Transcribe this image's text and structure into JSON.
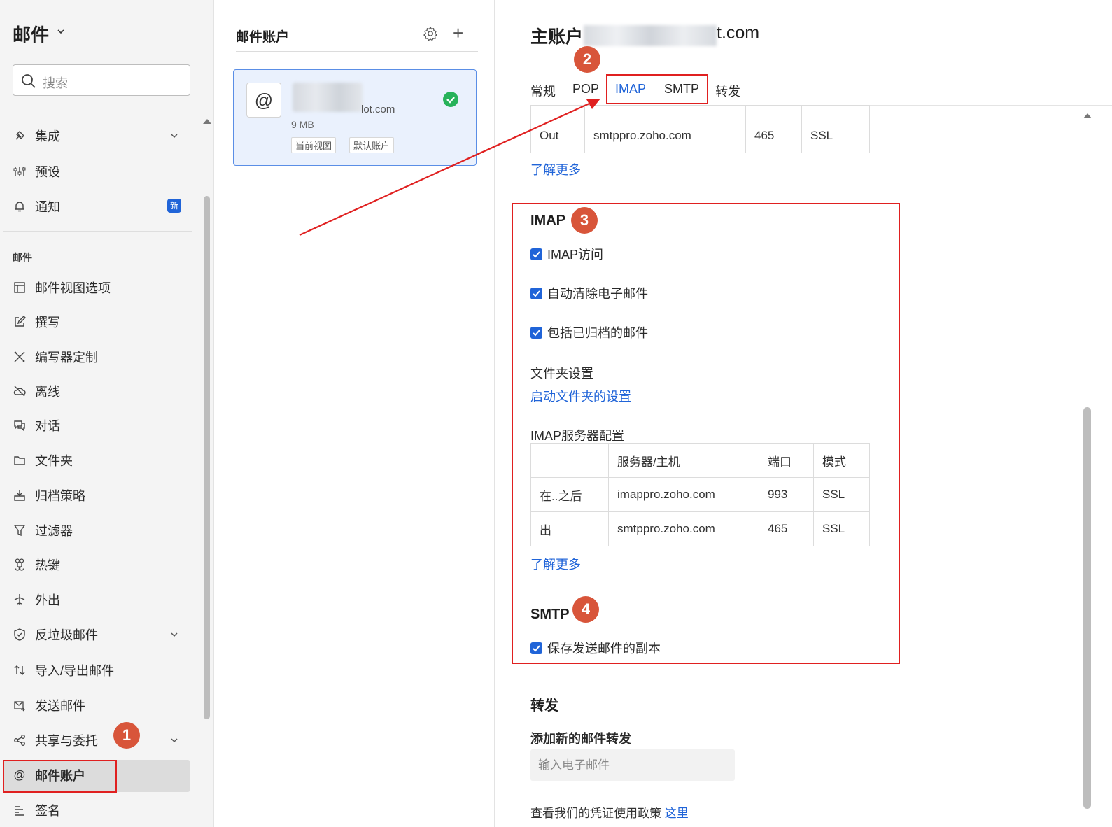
{
  "sidebar": {
    "app_title": "邮件",
    "search_placeholder": "搜索",
    "items_top": [
      {
        "label": "集成",
        "icon": "plug-icon",
        "has_chevron": true
      },
      {
        "label": "预设",
        "icon": "sliders-icon"
      },
      {
        "label": "通知",
        "icon": "bell-icon",
        "badge": "新"
      }
    ],
    "section_label": "邮件",
    "items_mail": [
      {
        "label": "邮件视图选项",
        "icon": "layout-icon"
      },
      {
        "label": "撰写",
        "icon": "compose-icon"
      },
      {
        "label": "编写器定制",
        "icon": "tools-icon"
      },
      {
        "label": "离线",
        "icon": "cloud-off-icon"
      },
      {
        "label": "对话",
        "icon": "chat-icon"
      },
      {
        "label": "文件夹",
        "icon": "folder-icon"
      },
      {
        "label": "归档策略",
        "icon": "archive-icon"
      },
      {
        "label": "过滤器",
        "icon": "filter-icon"
      },
      {
        "label": "热键",
        "icon": "command-icon"
      },
      {
        "label": "外出",
        "icon": "plane-icon"
      },
      {
        "label": "反垃圾邮件",
        "icon": "shield-icon",
        "has_chevron": true
      },
      {
        "label": "导入/导出邮件",
        "icon": "import-export-icon"
      },
      {
        "label": "发送邮件",
        "icon": "send-mail-icon"
      },
      {
        "label": "共享与委托",
        "icon": "share-icon",
        "has_chevron": true
      },
      {
        "label": "邮件账户",
        "icon": "at-icon",
        "active": true
      },
      {
        "label": "签名",
        "icon": "signature-icon"
      }
    ]
  },
  "middle": {
    "title": "邮件账户",
    "account": {
      "email_suffix": "lot.com",
      "size": "9 MB",
      "tags": [
        "当前视图",
        "默认账户"
      ]
    }
  },
  "right": {
    "heading_prefix": "主账户",
    "heading_suffix": "t.com",
    "tabs": [
      "常规",
      "POP",
      "IMAP",
      "SMTP",
      "转发"
    ],
    "active_tab": "IMAP",
    "pop_table_row": [
      "Out",
      "smtppro.zoho.com",
      "465",
      "SSL"
    ],
    "learn_more": "了解更多",
    "imap": {
      "title": "IMAP",
      "checkboxes": [
        "IMAP访问",
        "自动清除电子邮件",
        "包括已归档的邮件"
      ],
      "folder_settings_label": "文件夹设置",
      "folder_settings_link": "启动文件夹的设置",
      "server_config_label": "IMAP服务器配置",
      "table_headers": [
        "",
        "服务器/主机",
        "端口",
        "模式"
      ],
      "table_rows": [
        [
          "在..之后",
          "imappro.zoho.com",
          "993",
          "SSL"
        ],
        [
          "出",
          "smtppro.zoho.com",
          "465",
          "SSL"
        ]
      ],
      "learn_more": "了解更多"
    },
    "smtp": {
      "title": "SMTP",
      "checkbox": "保存发送邮件的副本"
    },
    "forward": {
      "title": "转发",
      "subtitle": "添加新的邮件转发",
      "input_placeholder": "输入电子邮件",
      "policy_text": "查看我们的凭证使用政策",
      "policy_link": "这里"
    }
  },
  "annotations": [
    "1",
    "2",
    "3",
    "4"
  ],
  "colors": {
    "accent": "#2064d8",
    "annotation_red": "#e02020",
    "annotation_badge": "#d8553a",
    "success": "#27b25a"
  }
}
